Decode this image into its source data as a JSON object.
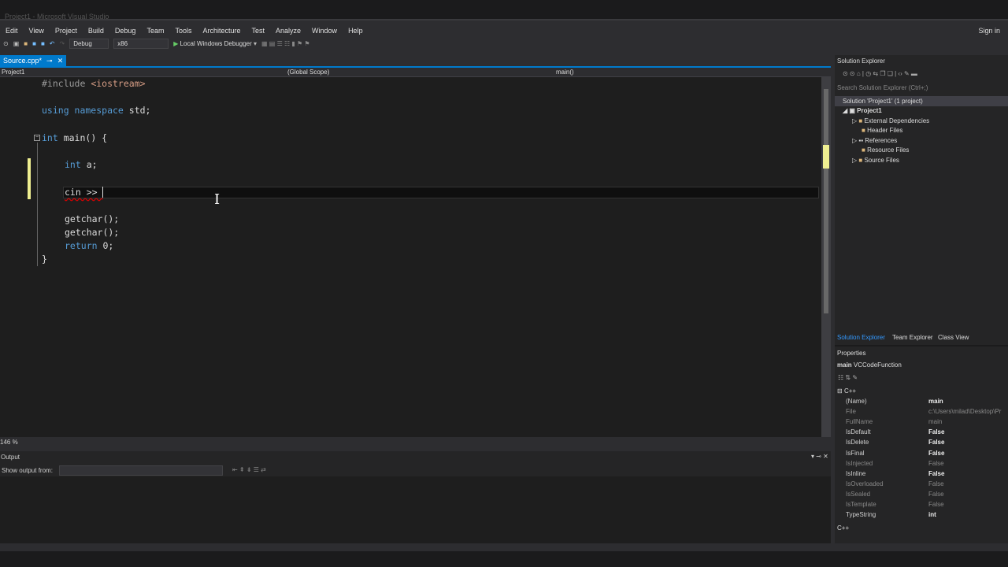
{
  "window": {
    "title": "Project1 - Microsoft Visual Studio",
    "sign_in": "Sign in"
  },
  "menu": [
    "Edit",
    "View",
    "Project",
    "Build",
    "Debug",
    "Team",
    "Tools",
    "Architecture",
    "Test",
    "Analyze",
    "Window",
    "Help"
  ],
  "toolbar": {
    "config": "Debug",
    "platform": "x86",
    "run": "Local Windows Debugger"
  },
  "tab": {
    "label": "Source.cpp*"
  },
  "navbar": {
    "project": "Project1",
    "scope": "(Global Scope)",
    "member": "main()"
  },
  "code": {
    "l1": "#include",
    "l1b": " <iostream>",
    "l2a": "using namespace",
    "l2b": " std;",
    "l3a": "int",
    "l3b": " main() {",
    "l4a": "int",
    "l4b": " a;",
    "l5": "cin >> ",
    "l6": "getchar();",
    "l7": "getchar();",
    "l8a": "return",
    "l8b": " 0;",
    "l9": "}"
  },
  "zoom": "146 %",
  "output": {
    "title": "Output",
    "show_from": "Show output from:"
  },
  "solution_explorer": {
    "title": "Solution Explorer",
    "search_placeholder": "Search Solution Explorer (Ctrl+;)",
    "solution": "Solution 'Project1' (1 project)",
    "project": "Project1",
    "items": [
      "External Dependencies",
      "Header Files",
      "References",
      "Resource Files",
      "Source Files"
    ],
    "tabs": [
      "Solution Explorer",
      "Team Explorer",
      "Class View"
    ]
  },
  "properties": {
    "title": "Properties",
    "object": "main",
    "object_type": "VCCodeFunction",
    "category": "C++",
    "rows": [
      {
        "name": "(Name)",
        "value": "main"
      },
      {
        "name": "File",
        "value": "c:\\Users\\milad\\Desktop\\Pr"
      },
      {
        "name": "FullName",
        "value": "main"
      },
      {
        "name": "IsDefault",
        "value": "False"
      },
      {
        "name": "IsDelete",
        "value": "False"
      },
      {
        "name": "IsFinal",
        "value": "False"
      },
      {
        "name": "IsInjected",
        "value": "False"
      },
      {
        "name": "IsInline",
        "value": "False"
      },
      {
        "name": "IsOverloaded",
        "value": "False"
      },
      {
        "name": "IsSealed",
        "value": "False"
      },
      {
        "name": "IsTemplate",
        "value": "False"
      },
      {
        "name": "TypeString",
        "value": "int"
      }
    ],
    "footer": "C++"
  }
}
